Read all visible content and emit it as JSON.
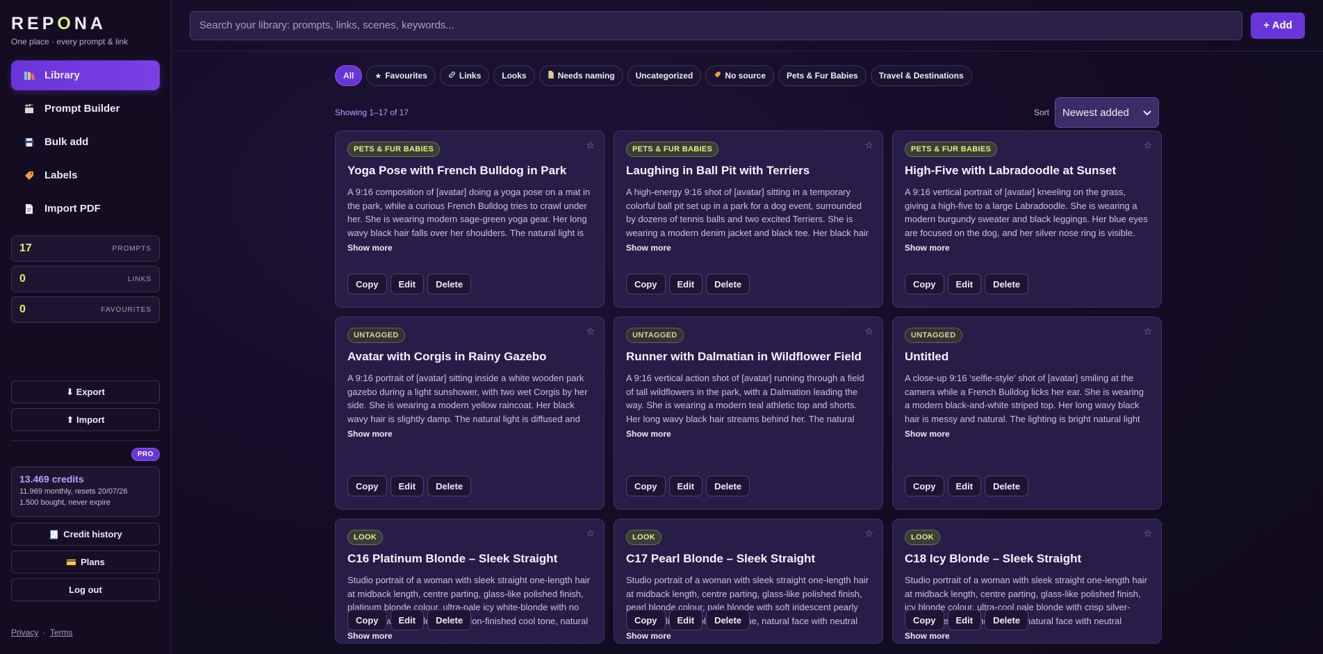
{
  "brand": {
    "name_pre": "REP",
    "name_o": "O",
    "name_post": "NA",
    "tagline": "One place · every prompt & link"
  },
  "nav": [
    {
      "label": "Library",
      "icon": "books-icon",
      "active": true
    },
    {
      "label": "Prompt Builder",
      "icon": "clapper-icon"
    },
    {
      "label": "Bulk add",
      "icon": "floppy-icon"
    },
    {
      "label": "Labels",
      "icon": "tag-icon"
    },
    {
      "label": "Import PDF",
      "icon": "document-icon"
    }
  ],
  "stats": [
    {
      "num": "17",
      "label": "PROMPTS"
    },
    {
      "num": "0",
      "label": "LINKS"
    },
    {
      "num": "0",
      "label": "FAVOURITES"
    }
  ],
  "sidebar_buttons": {
    "export": "⬇ Export",
    "import": "⬆ Import",
    "credit_history": "Credit history",
    "plans": "Plans",
    "logout": "Log out"
  },
  "plan_badge": "PRO",
  "credits": {
    "title": "13.469 credits",
    "monthly": "11.969 monthly, resets 20/07/26",
    "bought": "1.500 bought, never expire"
  },
  "footer": {
    "privacy": "Privacy",
    "sep": "·",
    "terms": "Terms"
  },
  "search": {
    "placeholder": "Search your library: prompts, links, scenes, keywords..."
  },
  "add_button": "+ Add",
  "filters": [
    {
      "label": "All",
      "active": true,
      "icon": ""
    },
    {
      "label": "Favourites",
      "icon": "★"
    },
    {
      "label": "Links",
      "icon": "🔗"
    },
    {
      "label": "Looks",
      "icon": ""
    },
    {
      "label": "Needs naming",
      "icon": "📄"
    },
    {
      "label": "Uncategorized",
      "icon": ""
    },
    {
      "label": "No source",
      "icon": "🏷"
    },
    {
      "label": "Pets & Fur Babies",
      "icon": ""
    },
    {
      "label": "Travel & Destinations",
      "icon": ""
    }
  ],
  "showing": "Showing 1–17 of 17",
  "sort": {
    "label": "Sort",
    "value": "Newest added"
  },
  "card_actions": {
    "copy": "Copy",
    "edit": "Edit",
    "delete": "Delete",
    "show_more": "Show more"
  },
  "cards": [
    {
      "tag": "PETS & FUR BABIES",
      "tag_kind": "pets",
      "title": "Yoga Pose with French Bulldog in Park",
      "text": "A 9:16 composition of [avatar] doing a yoga pose on a mat in the park, while a curious French Bulldog tries to crawl under her. She is wearing modern sage-green yoga gear. Her long wavy black hair falls over her shoulders. The natural light is soft morning light. The"
    },
    {
      "tag": "PETS & FUR BABIES",
      "tag_kind": "pets",
      "title": "Laughing in Ball Pit with Terriers",
      "text": "A high-energy 9:16 shot of [avatar] sitting in a temporary colorful ball pit set up in a park for a dog event, surrounded by dozens of tennis balls and two excited Terriers. She is wearing a modern denim jacket and black tee. Her black hair is messy and full of life. The"
    },
    {
      "tag": "PETS & FUR BABIES",
      "tag_kind": "pets",
      "title": "High-Five with Labradoodle at Sunset",
      "text": "A 9:16 vertical portrait of [avatar] kneeling on the grass, giving a high-five to a large Labradoodle. She is wearing a modern burgundy sweater and black leggings. Her blue eyes are focused on the dog, and her silver nose ring is visible. The natural light is warm and"
    },
    {
      "tag": "UNTAGGED",
      "tag_kind": "untag",
      "title": "Avatar with Corgis in Rainy Gazebo",
      "text": "A 9:16 portrait of [avatar] sitting inside a white wooden park gazebo during a light sunshower, with two wet Corgis by her side. She is wearing a modern yellow raincoat. Her black wavy hair is slightly damp. The natural light is diffused and soft. The color palette is"
    },
    {
      "tag": "UNTAGGED",
      "tag_kind": "untag",
      "title": "Runner with Dalmatian in Wildflower Field",
      "text": "A 9:16 vertical action shot of [avatar] running through a field of tall wildflowers in the park, with a Dalmation leading the way. She is wearing a modern teal athletic top and shorts. Her long wavy black hair streams behind her. The natural light is bright and highlights"
    },
    {
      "tag": "UNTAGGED",
      "tag_kind": "untag",
      "title": "Untitled",
      "text": "A close-up 9:16 'selfie-style' shot of [avatar] smiling at the camera while a French Bulldog licks her ear. She is wearing a modern black-and-white striped top. Her long wavy black hair is messy and natural. The lighting is bright natural light from the side. The color palette is"
    },
    {
      "tag": "LOOK",
      "tag_kind": "look",
      "title": "C16 Platinum Blonde – Sleek Straight",
      "text": "Studio portrait of a woman with sleek straight one-length hair at midback length, centre parting, glass-like polished finish, platinum blonde colour, ultra-pale icy white-blonde with no yellow or warm undertones, salon-finished cool tone, natural face with neutral"
    },
    {
      "tag": "LOOK",
      "tag_kind": "look",
      "title": "C17 Pearl Blonde – Sleek Straight",
      "text": "Studio portrait of a woman with sleek straight one-length hair at midback length, centre parting, glass-like polished finish, pearl blonde colour, pale blonde with soft iridescent pearly sheen, delicate cool-neutral tone, natural face with neutral expression, no visible makeup"
    },
    {
      "tag": "LOOK",
      "tag_kind": "look",
      "title": "C18 Icy Blonde – Sleek Straight",
      "text": "Studio portrait of a woman with sleek straight one-length hair at midback length, centre parting, glass-like polished finish, icy blonde colour, ultra-cool pale blonde with crisp silver-white undertones, no warmth, natural face with neutral expression, no visible makeup"
    }
  ]
}
